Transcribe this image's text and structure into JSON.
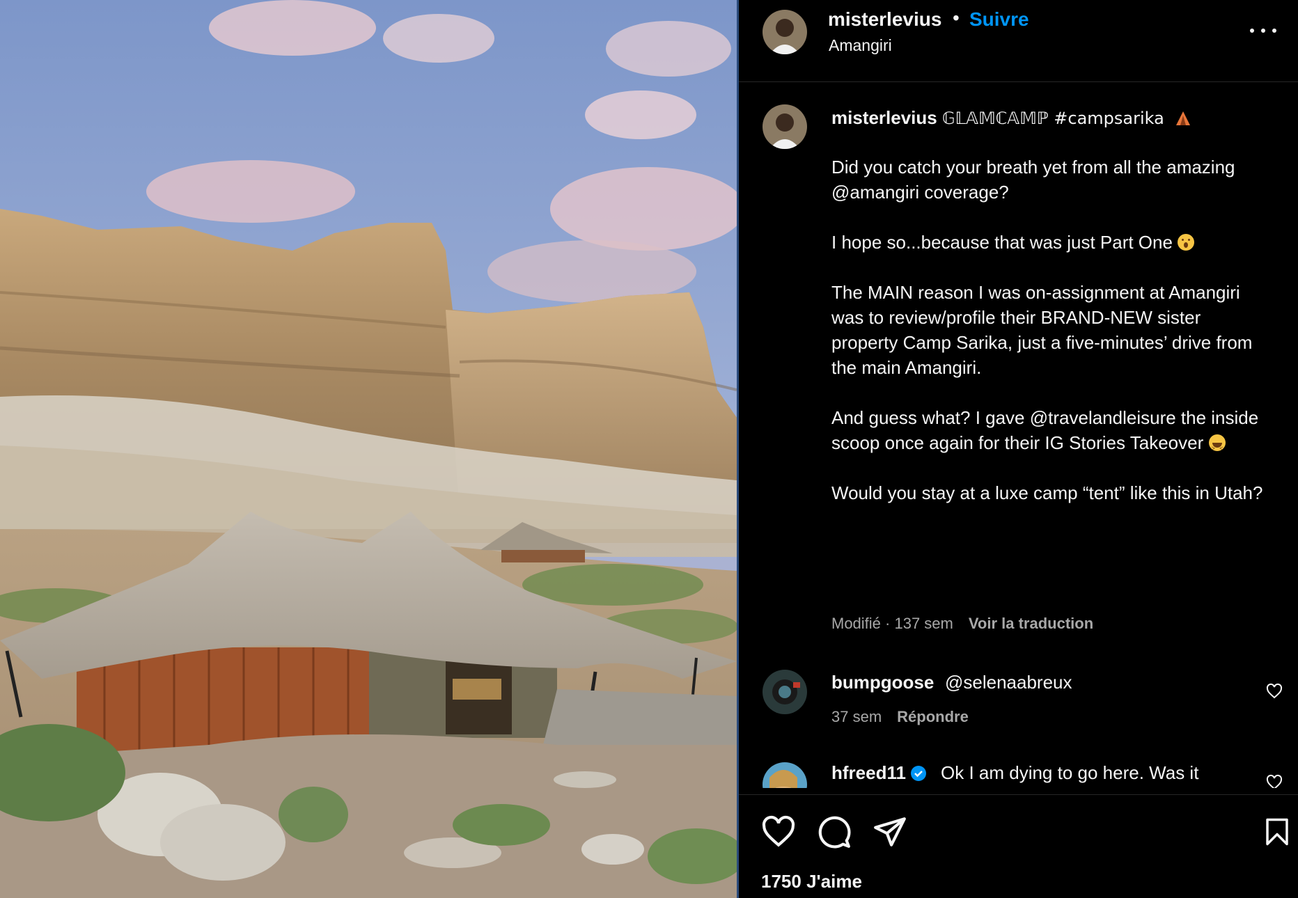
{
  "post": {
    "username": "misterlevius",
    "dot": "•",
    "follow_label": "Suivre",
    "location": "Amangiri"
  },
  "caption": {
    "username": "misterlevius",
    "title": "𝔾𝕃𝔸𝕄ℂ𝔸𝕄ℙ #campsarika",
    "paragraphs": [
      "Did you catch your breath yet from all the amazing @amangiri coverage?",
      "I hope so...because that was just Part One",
      "The MAIN reason I was on-assignment at Amangiri was to review/profile their BRAND-NEW sister property Camp Sarika, just a five-minutes’ drive from the main Amangiri.",
      "And guess what? I gave @travelandleisure the inside scoop once again for their IG Stories Takeover",
      "Would you stay at a luxe camp “tent” like this in Utah?"
    ],
    "meta_time": "Modifié · 137 sem",
    "translate_label": "Voir la traduction"
  },
  "comments": [
    {
      "username": "bumpgoose",
      "text": "@selenaabreux",
      "time": "37 sem",
      "reply_label": "Répondre"
    },
    {
      "username": "hfreed11",
      "text": "Ok I am dying to go here. Was it"
    }
  ],
  "actions": {
    "likes_text": "1750 J'aime"
  },
  "icons": [
    "more-icon",
    "heart-icon",
    "comment-icon",
    "share-icon",
    "bookmark-icon",
    "verified-icon",
    "tent-emoji"
  ],
  "colors": {
    "accent": "#0095f6",
    "background": "#000000",
    "muted": "#a8a8a8"
  }
}
